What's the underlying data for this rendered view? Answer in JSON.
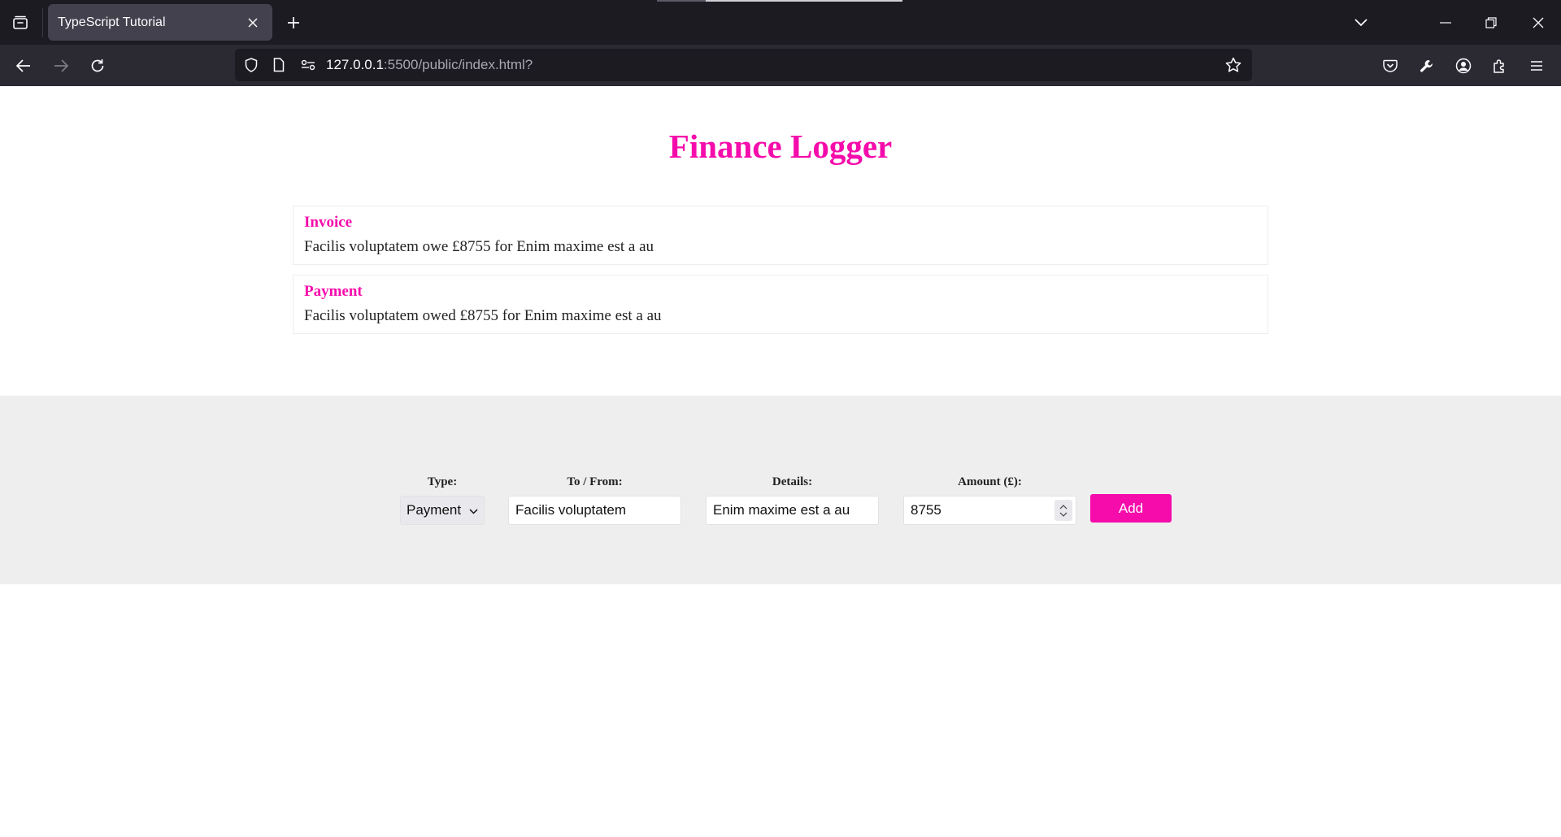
{
  "browser": {
    "tab_title": "TypeScript Tutorial",
    "url_host": "127.0.0.1",
    "url_rest": ":5500/public/index.html?"
  },
  "page": {
    "title": "Finance Logger",
    "items": [
      {
        "heading": "Invoice",
        "text": "Facilis voluptatem owe £8755 for Enim maxime est a au"
      },
      {
        "heading": "Payment",
        "text": "Facilis voluptatem owed £8755 for Enim maxime est a au"
      }
    ]
  },
  "form": {
    "type_label": "Type:",
    "type_value": "Payment",
    "tofrom_label": "To / From:",
    "tofrom_value": "Facilis voluptatem",
    "details_label": "Details:",
    "details_value": "Enim maxime est a au",
    "amount_label": "Amount (£):",
    "amount_value": "8755",
    "add_label": "Add"
  },
  "colors": {
    "accent": "#f50cab",
    "form_background": "#eeeeee",
    "chrome_dark": "#1c1b22"
  }
}
